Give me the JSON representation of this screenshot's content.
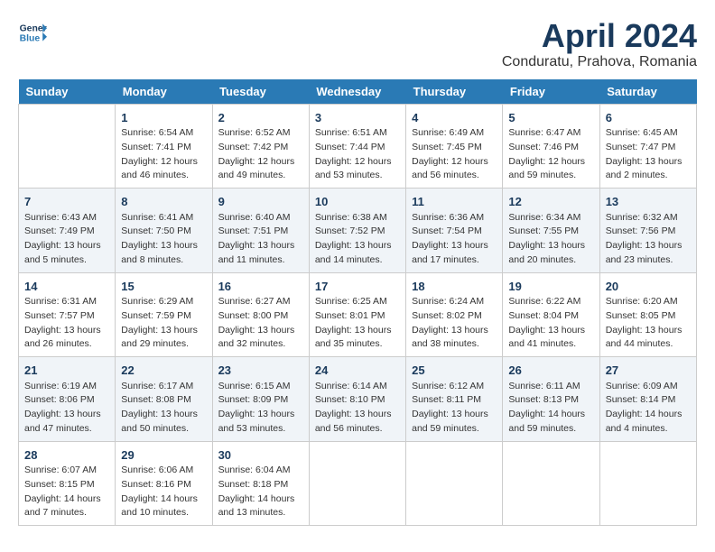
{
  "header": {
    "logo_line1": "General",
    "logo_line2": "Blue",
    "month_title": "April 2024",
    "subtitle": "Conduratu, Prahova, Romania"
  },
  "days_of_week": [
    "Sunday",
    "Monday",
    "Tuesday",
    "Wednesday",
    "Thursday",
    "Friday",
    "Saturday"
  ],
  "weeks": [
    [
      {
        "day": "",
        "data": ""
      },
      {
        "day": "1",
        "data": "Sunrise: 6:54 AM\nSunset: 7:41 PM\nDaylight: 12 hours\nand 46 minutes."
      },
      {
        "day": "2",
        "data": "Sunrise: 6:52 AM\nSunset: 7:42 PM\nDaylight: 12 hours\nand 49 minutes."
      },
      {
        "day": "3",
        "data": "Sunrise: 6:51 AM\nSunset: 7:44 PM\nDaylight: 12 hours\nand 53 minutes."
      },
      {
        "day": "4",
        "data": "Sunrise: 6:49 AM\nSunset: 7:45 PM\nDaylight: 12 hours\nand 56 minutes."
      },
      {
        "day": "5",
        "data": "Sunrise: 6:47 AM\nSunset: 7:46 PM\nDaylight: 12 hours\nand 59 minutes."
      },
      {
        "day": "6",
        "data": "Sunrise: 6:45 AM\nSunset: 7:47 PM\nDaylight: 13 hours\nand 2 minutes."
      }
    ],
    [
      {
        "day": "7",
        "data": "Sunrise: 6:43 AM\nSunset: 7:49 PM\nDaylight: 13 hours\nand 5 minutes."
      },
      {
        "day": "8",
        "data": "Sunrise: 6:41 AM\nSunset: 7:50 PM\nDaylight: 13 hours\nand 8 minutes."
      },
      {
        "day": "9",
        "data": "Sunrise: 6:40 AM\nSunset: 7:51 PM\nDaylight: 13 hours\nand 11 minutes."
      },
      {
        "day": "10",
        "data": "Sunrise: 6:38 AM\nSunset: 7:52 PM\nDaylight: 13 hours\nand 14 minutes."
      },
      {
        "day": "11",
        "data": "Sunrise: 6:36 AM\nSunset: 7:54 PM\nDaylight: 13 hours\nand 17 minutes."
      },
      {
        "day": "12",
        "data": "Sunrise: 6:34 AM\nSunset: 7:55 PM\nDaylight: 13 hours\nand 20 minutes."
      },
      {
        "day": "13",
        "data": "Sunrise: 6:32 AM\nSunset: 7:56 PM\nDaylight: 13 hours\nand 23 minutes."
      }
    ],
    [
      {
        "day": "14",
        "data": "Sunrise: 6:31 AM\nSunset: 7:57 PM\nDaylight: 13 hours\nand 26 minutes."
      },
      {
        "day": "15",
        "data": "Sunrise: 6:29 AM\nSunset: 7:59 PM\nDaylight: 13 hours\nand 29 minutes."
      },
      {
        "day": "16",
        "data": "Sunrise: 6:27 AM\nSunset: 8:00 PM\nDaylight: 13 hours\nand 32 minutes."
      },
      {
        "day": "17",
        "data": "Sunrise: 6:25 AM\nSunset: 8:01 PM\nDaylight: 13 hours\nand 35 minutes."
      },
      {
        "day": "18",
        "data": "Sunrise: 6:24 AM\nSunset: 8:02 PM\nDaylight: 13 hours\nand 38 minutes."
      },
      {
        "day": "19",
        "data": "Sunrise: 6:22 AM\nSunset: 8:04 PM\nDaylight: 13 hours\nand 41 minutes."
      },
      {
        "day": "20",
        "data": "Sunrise: 6:20 AM\nSunset: 8:05 PM\nDaylight: 13 hours\nand 44 minutes."
      }
    ],
    [
      {
        "day": "21",
        "data": "Sunrise: 6:19 AM\nSunset: 8:06 PM\nDaylight: 13 hours\nand 47 minutes."
      },
      {
        "day": "22",
        "data": "Sunrise: 6:17 AM\nSunset: 8:08 PM\nDaylight: 13 hours\nand 50 minutes."
      },
      {
        "day": "23",
        "data": "Sunrise: 6:15 AM\nSunset: 8:09 PM\nDaylight: 13 hours\nand 53 minutes."
      },
      {
        "day": "24",
        "data": "Sunrise: 6:14 AM\nSunset: 8:10 PM\nDaylight: 13 hours\nand 56 minutes."
      },
      {
        "day": "25",
        "data": "Sunrise: 6:12 AM\nSunset: 8:11 PM\nDaylight: 13 hours\nand 59 minutes."
      },
      {
        "day": "26",
        "data": "Sunrise: 6:11 AM\nSunset: 8:13 PM\nDaylight: 14 hours\nand 59 minutes."
      },
      {
        "day": "27",
        "data": "Sunrise: 6:09 AM\nSunset: 8:14 PM\nDaylight: 14 hours\nand 4 minutes."
      }
    ],
    [
      {
        "day": "28",
        "data": "Sunrise: 6:07 AM\nSunset: 8:15 PM\nDaylight: 14 hours\nand 7 minutes."
      },
      {
        "day": "29",
        "data": "Sunrise: 6:06 AM\nSunset: 8:16 PM\nDaylight: 14 hours\nand 10 minutes."
      },
      {
        "day": "30",
        "data": "Sunrise: 6:04 AM\nSunset: 8:18 PM\nDaylight: 14 hours\nand 13 minutes."
      },
      {
        "day": "",
        "data": ""
      },
      {
        "day": "",
        "data": ""
      },
      {
        "day": "",
        "data": ""
      },
      {
        "day": "",
        "data": ""
      }
    ]
  ]
}
